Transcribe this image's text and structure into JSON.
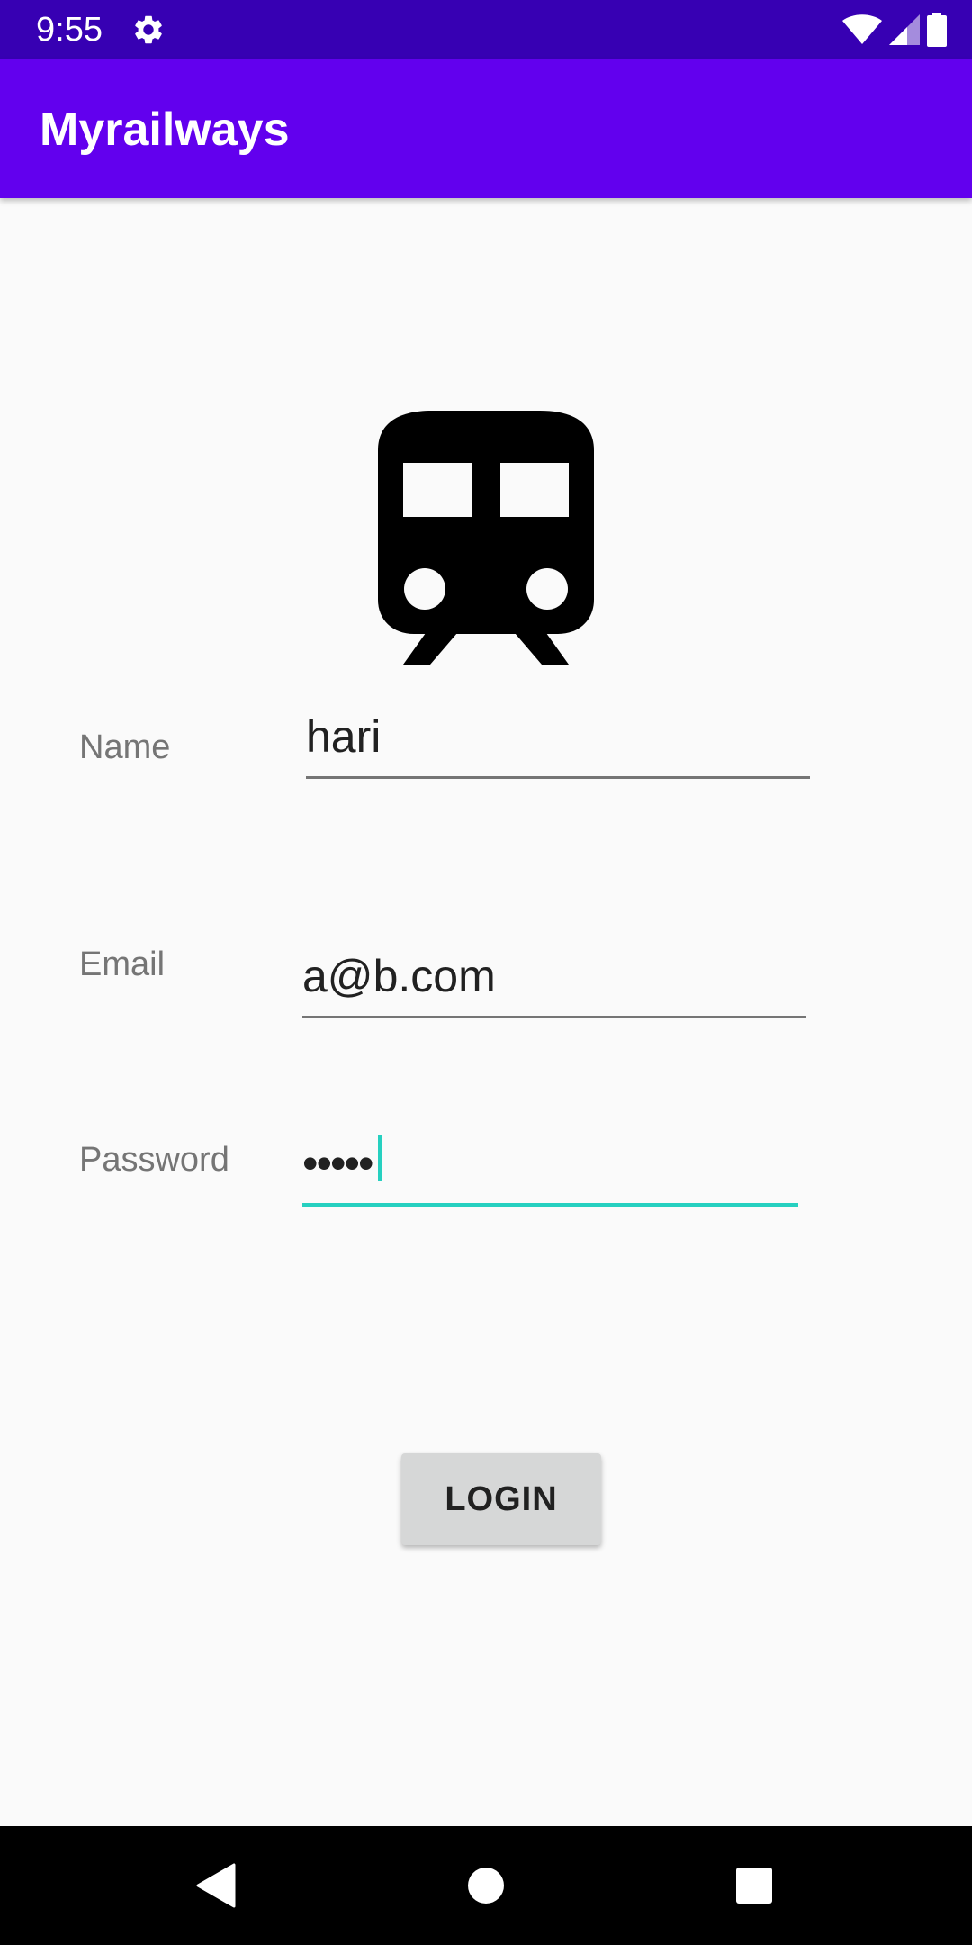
{
  "status_bar": {
    "time": "9:55",
    "icons": [
      "gear-icon",
      "wifi-icon",
      "cellular-signal-icon",
      "battery-icon"
    ]
  },
  "app_bar": {
    "title": "Myrailways"
  },
  "logo": {
    "icon": "train-icon"
  },
  "form": {
    "name_label": "Name",
    "name_value": "hari",
    "email_label": "Email",
    "email_value": "a@b.com",
    "password_label": "Password",
    "password_value": "•••••"
  },
  "login_button": {
    "label": "LOGIN"
  },
  "nav_bar": {
    "icons": [
      "back-icon",
      "home-icon",
      "recents-icon"
    ]
  },
  "colors": {
    "status_bar": "#3700b3",
    "app_bar": "#6200ee",
    "focus_accent": "#26d0c0",
    "background": "#fafafa",
    "button": "#d6d7d7"
  }
}
